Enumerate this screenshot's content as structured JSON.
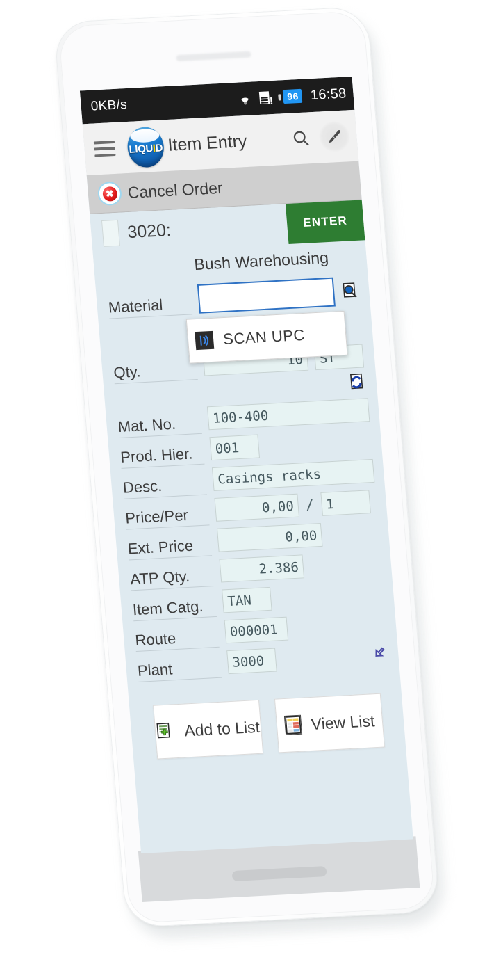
{
  "statusbar": {
    "network_speed": "0KB/s",
    "wifi_icon": "wifi-icon",
    "sim_icon": "sim-card-alert-icon",
    "battery_level": "96",
    "clock": "16:58"
  },
  "appbar": {
    "menu_icon": "hamburger-menu-icon",
    "logo_text_a": "LIQU",
    "logo_text_i": "I",
    "logo_text_b": "D",
    "title": "Item Entry",
    "search_icon": "search-icon",
    "brush_icon": "brush-icon"
  },
  "subbar": {
    "cancel_icon": "cancel-order-icon",
    "cancel_glyph": "✖",
    "label": "Cancel Order"
  },
  "header": {
    "sold_to_value": "",
    "customer_no": "3020:",
    "customer_name": "Bush Warehousing",
    "enter_label": "ENTER"
  },
  "form": {
    "material": {
      "label": "Material",
      "value": "",
      "lookup_icon": "document-search-icon"
    },
    "scan_popup": {
      "icon": "barcode-scan-icon",
      "label": "SCAN UPC"
    },
    "qty": {
      "label": "Qty.",
      "value": "10",
      "unit": "ST",
      "refresh_icon": "document-refresh-icon"
    },
    "mat_no": {
      "label": "Mat. No.",
      "value": "100-400"
    },
    "prod_hier": {
      "label": "Prod. Hier.",
      "value": "001"
    },
    "desc": {
      "label": "Desc.",
      "value": "Casings racks"
    },
    "price_per": {
      "label": "Price/Per",
      "value": "0,00",
      "separator": "/",
      "per": "1"
    },
    "ext_price": {
      "label": "Ext. Price",
      "value": "0,00"
    },
    "atp_qty": {
      "label": "ATP Qty.",
      "value": "2.386"
    },
    "item_catg": {
      "label": "Item Catg.",
      "value": "TAN"
    },
    "route": {
      "label": "Route",
      "value": "000001"
    },
    "plant": {
      "label": "Plant",
      "value": "3000",
      "undo_icon": "undo-arrow-icon"
    }
  },
  "actions": {
    "add_to_list": {
      "label": "Add to List",
      "icon": "add-to-list-icon"
    },
    "view_list": {
      "label": "View List",
      "icon": "view-list-icon"
    }
  },
  "colors": {
    "enter_green": "#2e7d32",
    "screen_bg": "#dfeaf0",
    "field_bg": "#e6f2f2",
    "focus_blue": "#2f72c4",
    "battery_blue": "#2196f3",
    "statusbar_black": "#1c1c1c",
    "logo_blue": "#0b4f9e",
    "logo_yellow": "#ffd400"
  }
}
